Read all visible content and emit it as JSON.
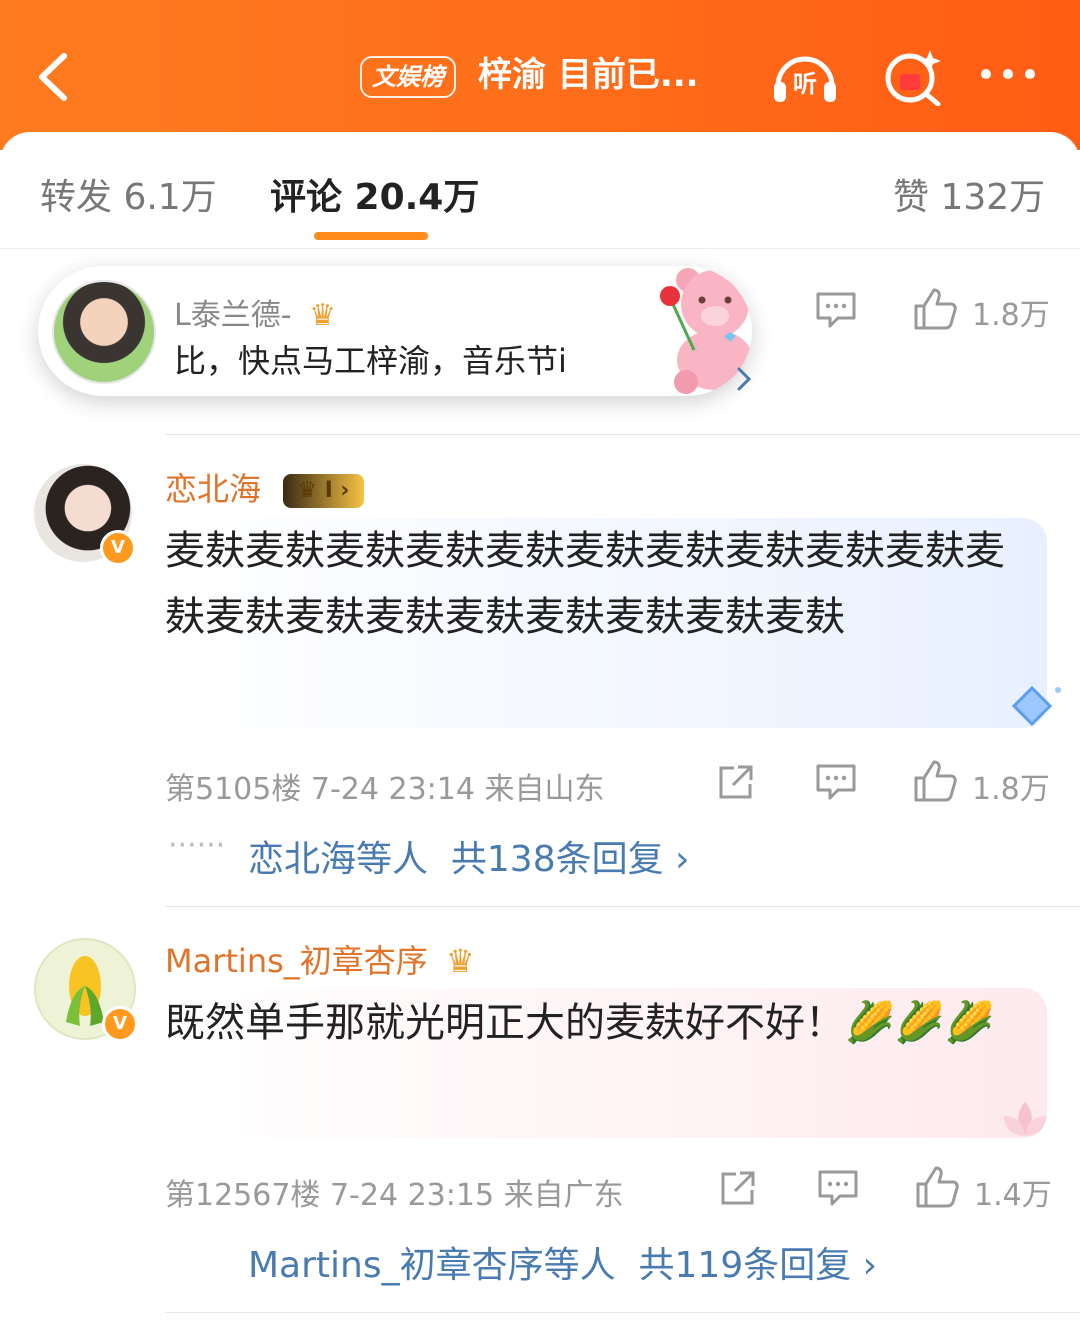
{
  "header": {
    "badge": "文娱榜",
    "title": "梓渝 目前已...",
    "listen_label": "听"
  },
  "tabs": {
    "repost": "转发 6.1万",
    "comment": "评论 20.4万",
    "like": "赞 132万"
  },
  "popup": {
    "name": "L泰兰德-",
    "text": "比，快点马工梓渝，音乐节i"
  },
  "top_actions": {
    "like_count": "1.8万"
  },
  "comments": [
    {
      "username": "恋北海",
      "level": "I",
      "text": "麦麸麦麸麦麸麦麸麦麸麦麸麦麸麦麸麦麸麦麸麦麸麦麸麦麸麦麸麦麸麦麸麦麸麦麸麦麸",
      "meta": "第5105楼  7-24 23:14  来自山东",
      "like_count": "1.8万",
      "reply_user": "恋北海等人",
      "reply_count": "共138条回复 ›"
    },
    {
      "username": "Martins_初章杏序",
      "text": "既然单手那就光明正大的麦麸好不好！🌽🌽🌽",
      "meta": "第12567楼  7-24 23:15  来自广东",
      "like_count": "1.4万",
      "reply_user": "Martins_初章杏序等人",
      "reply_count": "共119条回复 ›"
    }
  ],
  "colors": {
    "header_orange": "#ff6e1a",
    "username": "#e0742a",
    "reply_link": "#4a7bb0",
    "tab_underline": "#ff8c1a"
  }
}
